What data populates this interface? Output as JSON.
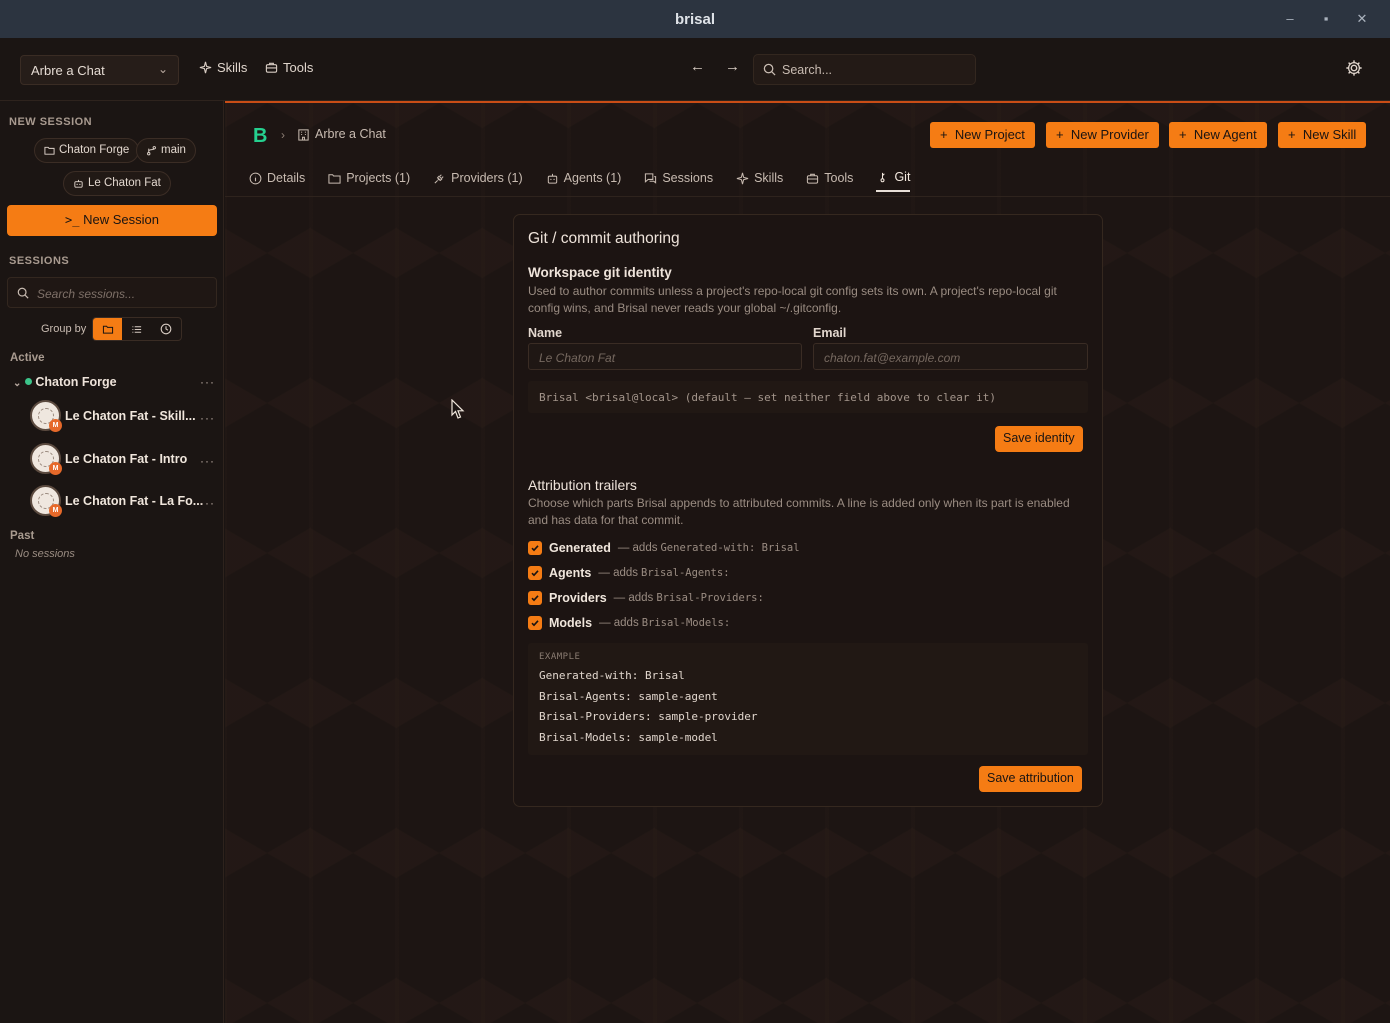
{
  "window": {
    "title": "brisal"
  },
  "topbar": {
    "workspace": "Arbre a Chat",
    "nav": {
      "skills": "Skills",
      "tools": "Tools"
    },
    "search_placeholder": "Search..."
  },
  "sidebar": {
    "new_session_header": "NEW SESSION",
    "chips": {
      "project": "Chaton Forge",
      "branch": "main",
      "agent": "Le Chaton Fat"
    },
    "new_session_button": "New Session",
    "sessions_header": "SESSIONS",
    "search_placeholder": "Search sessions...",
    "group_by_label": "Group by",
    "active_label": "Active",
    "project_group": "Chaton Forge",
    "sessions": [
      {
        "name": "Le Chaton Fat - Skill...",
        "badge": "M"
      },
      {
        "name": "Le Chaton Fat - Intro",
        "badge": "M"
      },
      {
        "name": "Le Chaton Fat - La Fo...",
        "badge": "M"
      }
    ],
    "past_label": "Past",
    "no_sessions": "No sessions"
  },
  "main": {
    "logo": "B",
    "breadcrumb": "Arbre a Chat",
    "actions": {
      "new_project": "New Project",
      "new_provider": "New Provider",
      "new_agent": "New Agent",
      "new_skill": "New Skill"
    },
    "tabs": {
      "details": "Details",
      "projects": "Projects (1)",
      "providers": "Providers (1)",
      "agents": "Agents (1)",
      "sessions": "Sessions",
      "skills": "Skills",
      "tools": "Tools",
      "git": "Git"
    }
  },
  "git": {
    "title": "Git / commit authoring",
    "identity": {
      "heading": "Workspace git identity",
      "desc": "Used to author commits unless a project's repo-local git config sets its own. A project's repo-local git config wins, and Brisal never reads your global ~/.gitconfig.",
      "name_label": "Name",
      "name_placeholder": "Le Chaton Fat",
      "email_label": "Email",
      "email_placeholder": "chaton.fat@example.com",
      "default_text": "Brisal <brisal@local> (default — set neither field above to clear it)",
      "save_button": "Save identity"
    },
    "attribution": {
      "heading": "Attribution trailers",
      "desc": "Choose which parts Brisal appends to attributed commits. A line is added only when its part is enabled and has data for that commit.",
      "trailers": [
        {
          "label": "Generated",
          "desc": "— adds",
          "code": "Generated-with: Brisal"
        },
        {
          "label": "Agents",
          "desc": "— adds",
          "code": "Brisal-Agents:"
        },
        {
          "label": "Providers",
          "desc": "— adds",
          "code": "Brisal-Providers:"
        },
        {
          "label": "Models",
          "desc": "— adds",
          "code": "Brisal-Models:"
        }
      ],
      "example_title": "EXAMPLE",
      "example_lines": [
        "Generated-with: Brisal",
        "Brisal-Agents: sample-agent",
        "Brisal-Providers: sample-provider",
        "Brisal-Models: sample-model"
      ],
      "save_button": "Save attribution"
    }
  },
  "colors": {
    "accent": "#f57c14",
    "logo": "#25d08f",
    "active_dot": "#3cc48a"
  }
}
